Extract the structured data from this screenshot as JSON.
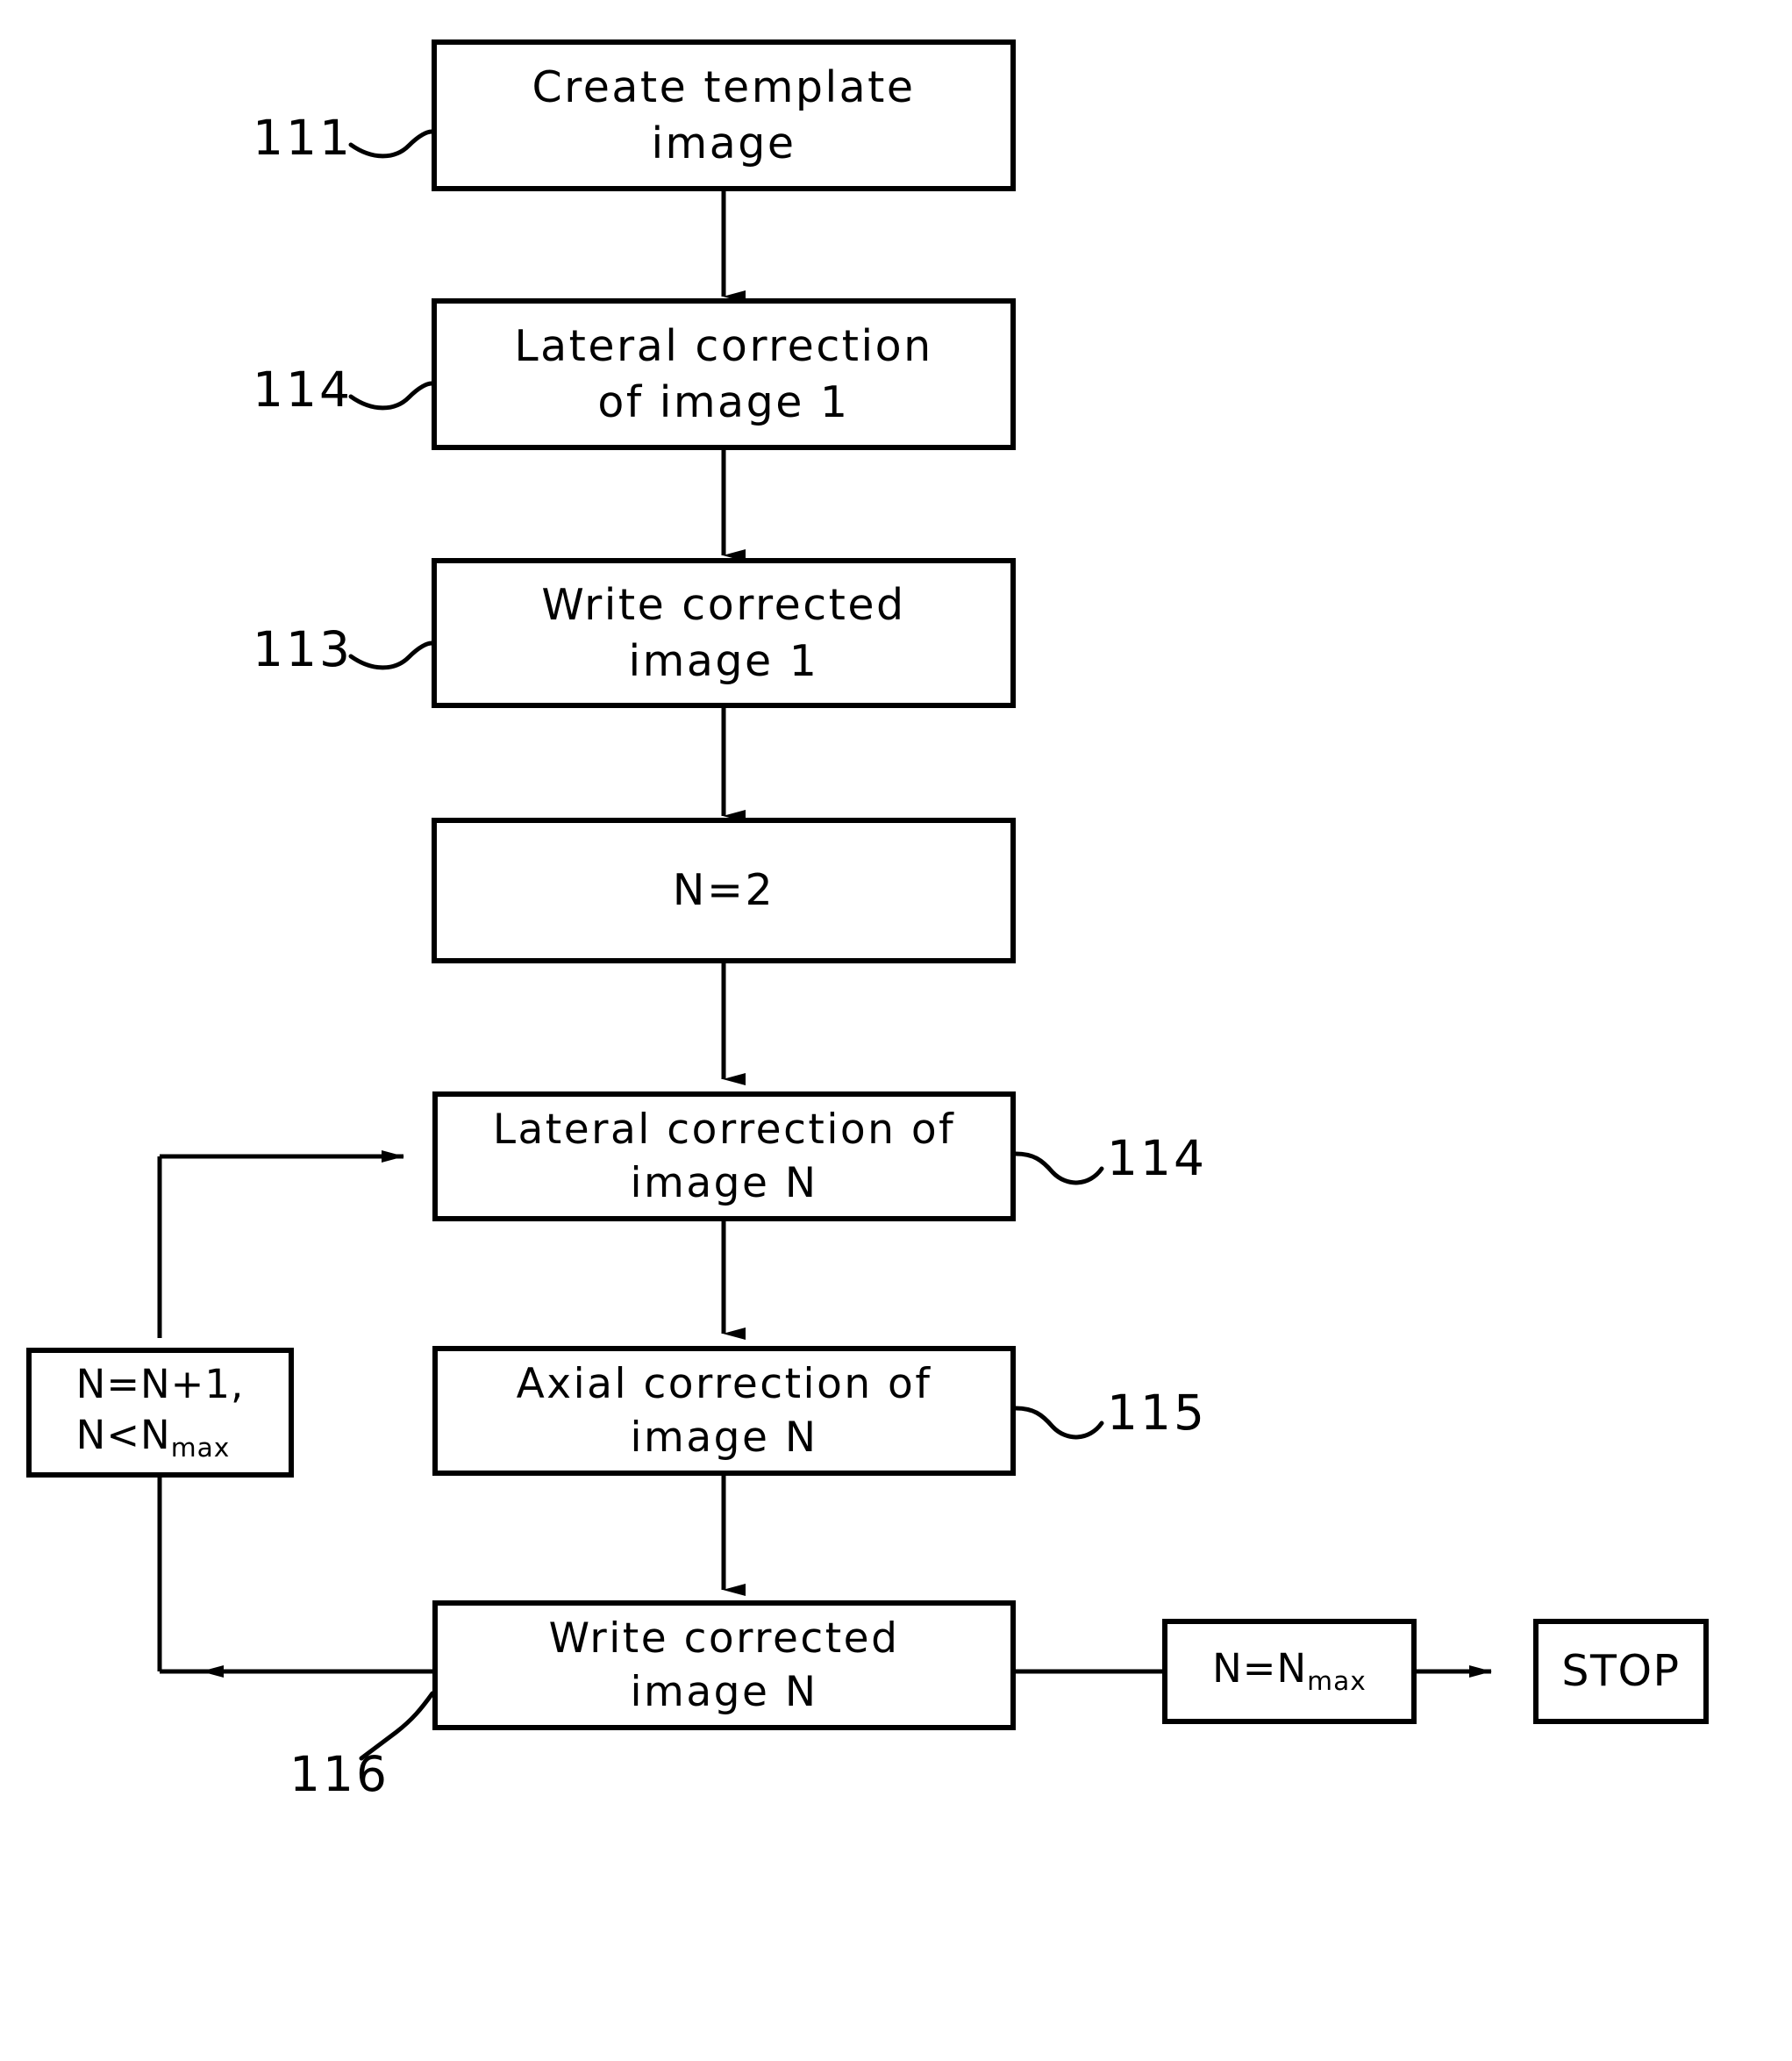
{
  "figure": {
    "type": "flowchart",
    "title": "",
    "boxes": [
      {
        "id": "create-template-image",
        "ref": "111",
        "ref_side": "left",
        "lines": [
          "Create  template",
          "image"
        ]
      },
      {
        "id": "lateral-correction-image-1",
        "ref": "114",
        "ref_side": "left",
        "lines": [
          "Lateral  correction",
          "of  image  1"
        ]
      },
      {
        "id": "write-corrected-image-1",
        "ref": "113",
        "ref_side": "left",
        "lines": [
          "Write  corrected",
          "image  1"
        ]
      },
      {
        "id": "set-n-2",
        "ref": "",
        "ref_side": "",
        "lines": [
          "N=2"
        ]
      },
      {
        "id": "lateral-correction-image-n",
        "ref": "114",
        "ref_side": "right",
        "lines": [
          "Lateral  correction  of",
          "image  N"
        ]
      },
      {
        "id": "axial-correction-image-n",
        "ref": "115",
        "ref_side": "right",
        "lines": [
          "Axial  correction  of",
          "image  N"
        ]
      },
      {
        "id": "write-corrected-image-n",
        "ref": "116",
        "ref_side": "bottom-left",
        "lines": [
          "Write  corrected",
          "image  N"
        ]
      },
      {
        "id": "increment-n",
        "ref": "",
        "ref_side": "",
        "lines": [
          "N=N+1,",
          "N<N",
          "max"
        ]
      },
      {
        "id": "n-equals-nmax",
        "ref": "",
        "ref_side": "",
        "lines": [
          "N=N",
          "max"
        ]
      },
      {
        "id": "stop",
        "ref": "",
        "ref_side": "",
        "lines": [
          "STOP"
        ]
      }
    ],
    "labels": {
      "create_template_l1": "Create  template",
      "create_template_l2": "image",
      "lateral_1_l1": "Lateral  correction",
      "lateral_1_l2": "of  image  1",
      "write_1_l1": "Write  corrected",
      "write_1_l2": "image  1",
      "set_n_2": "N=2",
      "lateral_n_l1": "Lateral  correction  of",
      "lateral_n_l2": "image  N",
      "axial_n_l1": "Axial  correction  of",
      "axial_n_l2": "image  N",
      "write_n_l1": "Write  corrected",
      "write_n_l2": "image  N",
      "incr_l1": "N=N+1,",
      "incr_l2_base": "N<N",
      "incr_l2_sub": "max",
      "nmax_base": "N=N",
      "nmax_sub": "max",
      "stop": "STOP"
    },
    "references": {
      "r111": "111",
      "r114a": "114",
      "r113": "113",
      "r114b": "114",
      "r115": "115",
      "r116": "116"
    },
    "colors": {
      "line": "#000000",
      "background": "#ffffff",
      "text": "#000000"
    }
  }
}
